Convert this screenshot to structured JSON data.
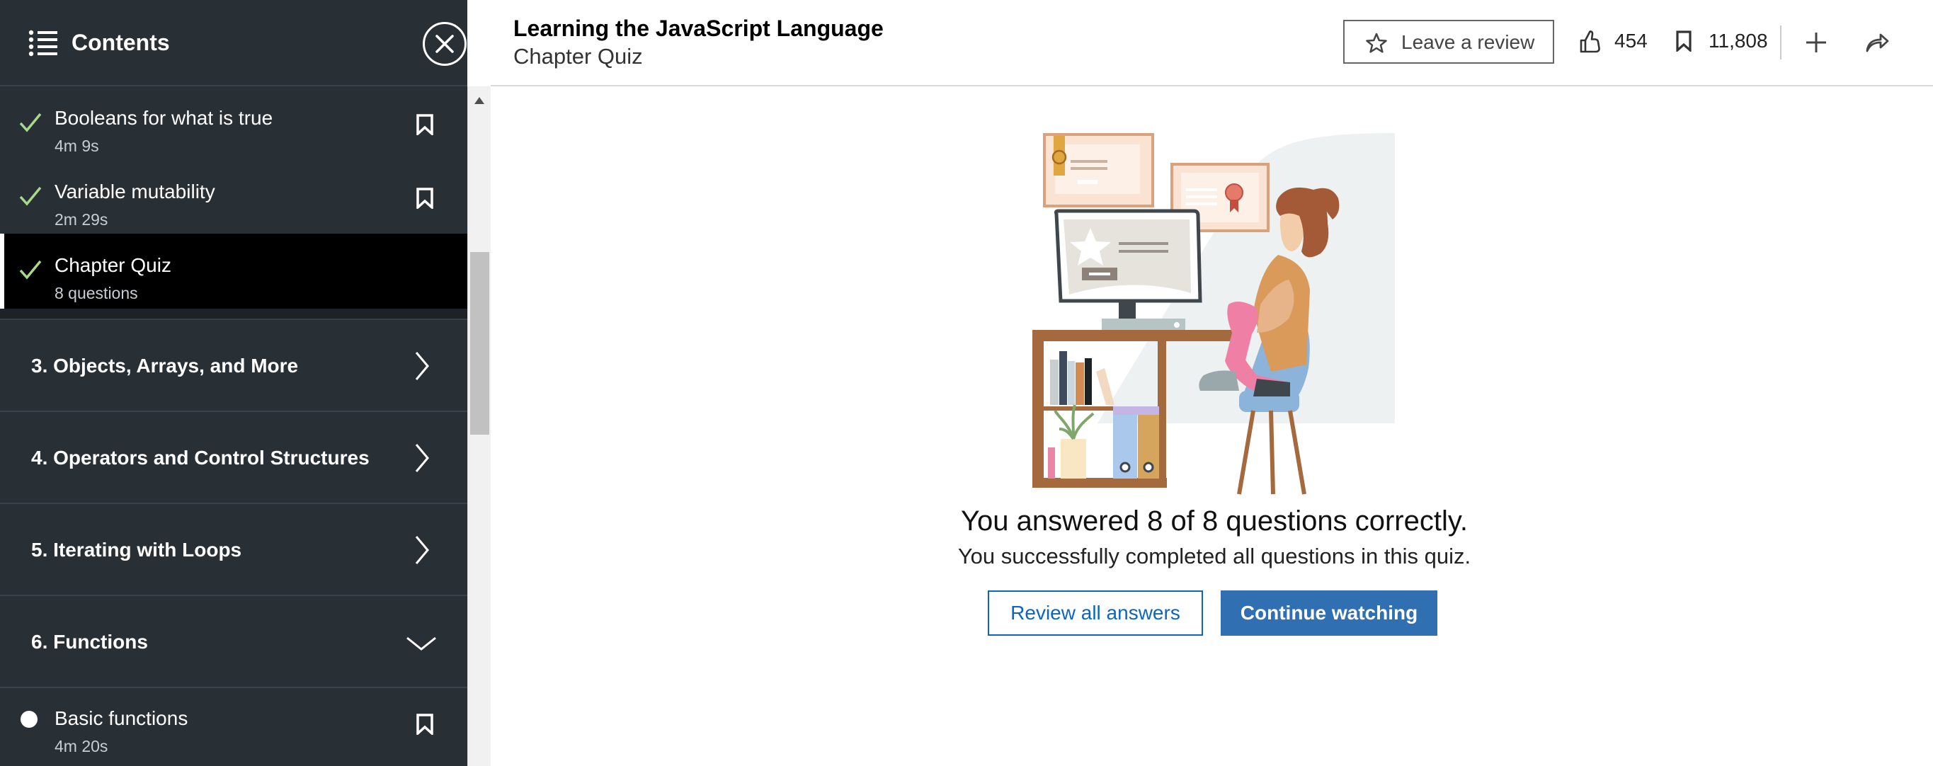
{
  "sidebar": {
    "title": "Contents",
    "videos": [
      {
        "title": "Booleans for what is true",
        "meta": "4m 9s"
      },
      {
        "title": "Variable mutability",
        "meta": "2m 29s"
      },
      {
        "title": "Chapter Quiz",
        "meta": "8 questions"
      },
      {
        "title": "Basic functions",
        "meta": "4m 20s"
      }
    ],
    "sections": [
      {
        "title": "3. Objects, Arrays, and More",
        "state": "collapsed"
      },
      {
        "title": "4. Operators and Control Structures",
        "state": "collapsed"
      },
      {
        "title": "5. Iterating with Loops",
        "state": "collapsed"
      },
      {
        "title": "6. Functions",
        "state": "expanded"
      }
    ]
  },
  "header": {
    "course_title": "Learning the JavaScript Language",
    "subtitle": "Chapter Quiz",
    "review_label": "Leave a review",
    "likes": "454",
    "saves": "11,808"
  },
  "result": {
    "title": "You answered 8 of 8 questions correctly.",
    "subtitle": "You successfully completed all questions in this quiz.",
    "review_button": "Review all answers",
    "continue_button": "Continue watching"
  },
  "colors": {
    "sidebar_bg": "#283036",
    "active_bg": "#000000",
    "check": "#a8d98a",
    "primary": "#2f6fb2",
    "link": "#0a66c2"
  }
}
